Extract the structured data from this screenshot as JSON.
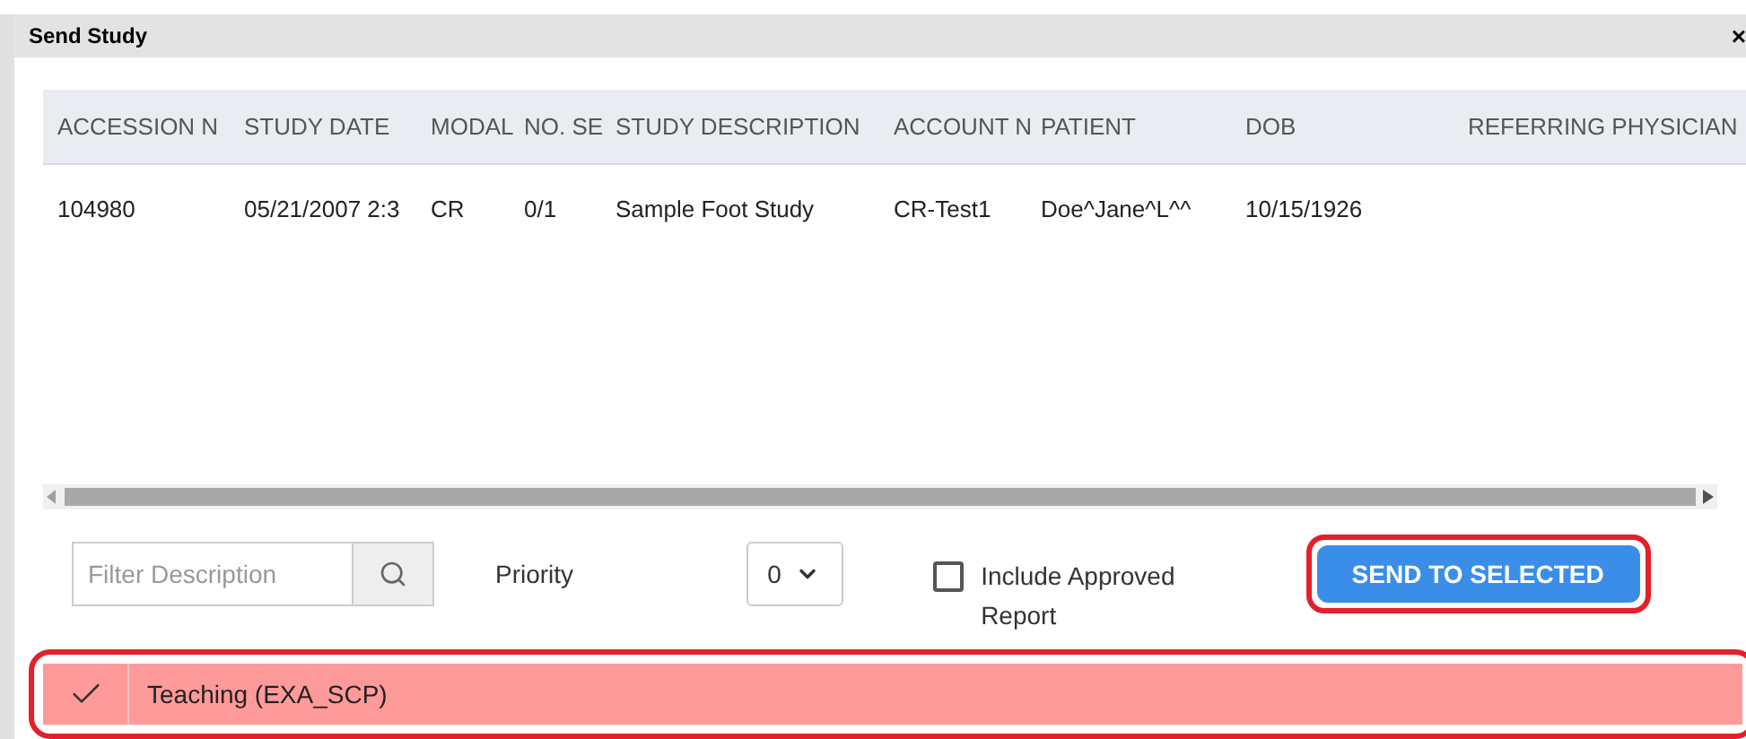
{
  "window": {
    "title": "Send Study",
    "close": "×"
  },
  "table": {
    "columns": [
      "ACCESSION N",
      "STUDY DATE",
      "MODAL",
      "NO. SE",
      "STUDY DESCRIPTION",
      "ACCOUNT N",
      "PATIENT",
      "DOB",
      "REFERRING PHYSICIAN"
    ],
    "rows": [
      [
        "104980",
        "05/21/2007 2:3",
        "CR",
        "0/1",
        "Sample Foot Study",
        "CR-Test1",
        "Doe^Jane^L^^",
        "10/15/1926",
        ""
      ]
    ]
  },
  "filter": {
    "placeholder": "Filter Description"
  },
  "priority": {
    "label": "Priority",
    "value": "0"
  },
  "include_report": {
    "label": "Include Approved Report",
    "checked": false
  },
  "send_button": {
    "label": "SEND TO SELECTED",
    "highlighted": true
  },
  "destinations": [
    {
      "label": "Teaching (EXA_SCP)",
      "selected": true,
      "highlighted": true
    }
  ]
}
